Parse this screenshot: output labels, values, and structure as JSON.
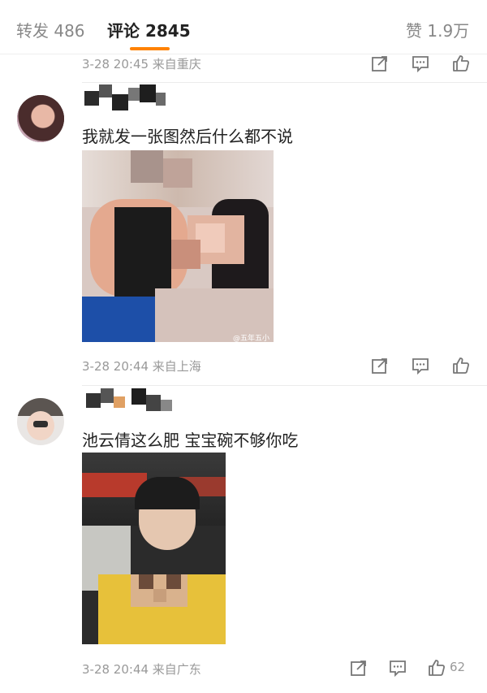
{
  "tabs": {
    "repost": "转发 486",
    "comment": "评论 2845",
    "like": "赞 1.9万"
  },
  "comments": [
    {
      "meta": "3-28 20:45 来自重庆"
    },
    {
      "text": "我就发一张图然后什么都不说",
      "meta": "3-28 20:44 来自上海",
      "image_watermark": "@五年五小时"
    },
    {
      "text": "池云倩这么肥 宝宝碗不够你吃",
      "meta": "3-28 20:44 来自广东",
      "like_count": "62"
    }
  ],
  "icons": {
    "share": "share-icon",
    "reply": "comment-icon",
    "like": "thumbs-up-icon"
  },
  "colors": {
    "accent": "#ff8200",
    "meta_text": "#999999"
  }
}
